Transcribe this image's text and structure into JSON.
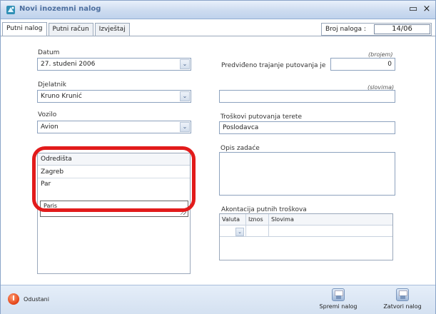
{
  "window": {
    "title": "Novi inozemni nalog",
    "maximize_icon": "maximize-icon",
    "close_icon": "close-icon"
  },
  "tabs": [
    {
      "label": "Putni nalog"
    },
    {
      "label": "Putni račun"
    },
    {
      "label": "Izvještaj"
    }
  ],
  "order": {
    "label": "Broj naloga :",
    "value": "14/06"
  },
  "form": {
    "datum_label": "Datum",
    "datum_value": "27. studeni 2006",
    "djelatnik_label": "Djelatnik",
    "djelatnik_value": "Kruno Krunić",
    "vozilo_label": "Vozilo",
    "vozilo_value": "Avion",
    "brojem_hint": "(brojem)",
    "trajanje_label": "Predviđeno trajanje putovanja je",
    "trajanje_value": "0",
    "slovima_hint": "(slovima)",
    "slovima_value": "",
    "troskovi_label": "Troškovi putovanja terete",
    "troskovi_value": "Poslodavca",
    "opis_label": "Opis zadaće",
    "opis_value": "",
    "akontacija_label": "Akontacija putnih troškova"
  },
  "destinations": {
    "header": "Odredišta",
    "items": [
      "Zagreb",
      "Par"
    ],
    "editing_value": "Paris"
  },
  "advance_table": {
    "headers": [
      "Valuta",
      "Iznos",
      "Slovima"
    ],
    "rows": [
      [
        "",
        "",
        ""
      ]
    ]
  },
  "footer": {
    "cancel_label": "Odustani",
    "save_label": "Spremi nalog",
    "open_label": "Zatvori nalog"
  },
  "colors": {
    "highlight": "#e21b1b",
    "title": "#4d6f9f"
  }
}
